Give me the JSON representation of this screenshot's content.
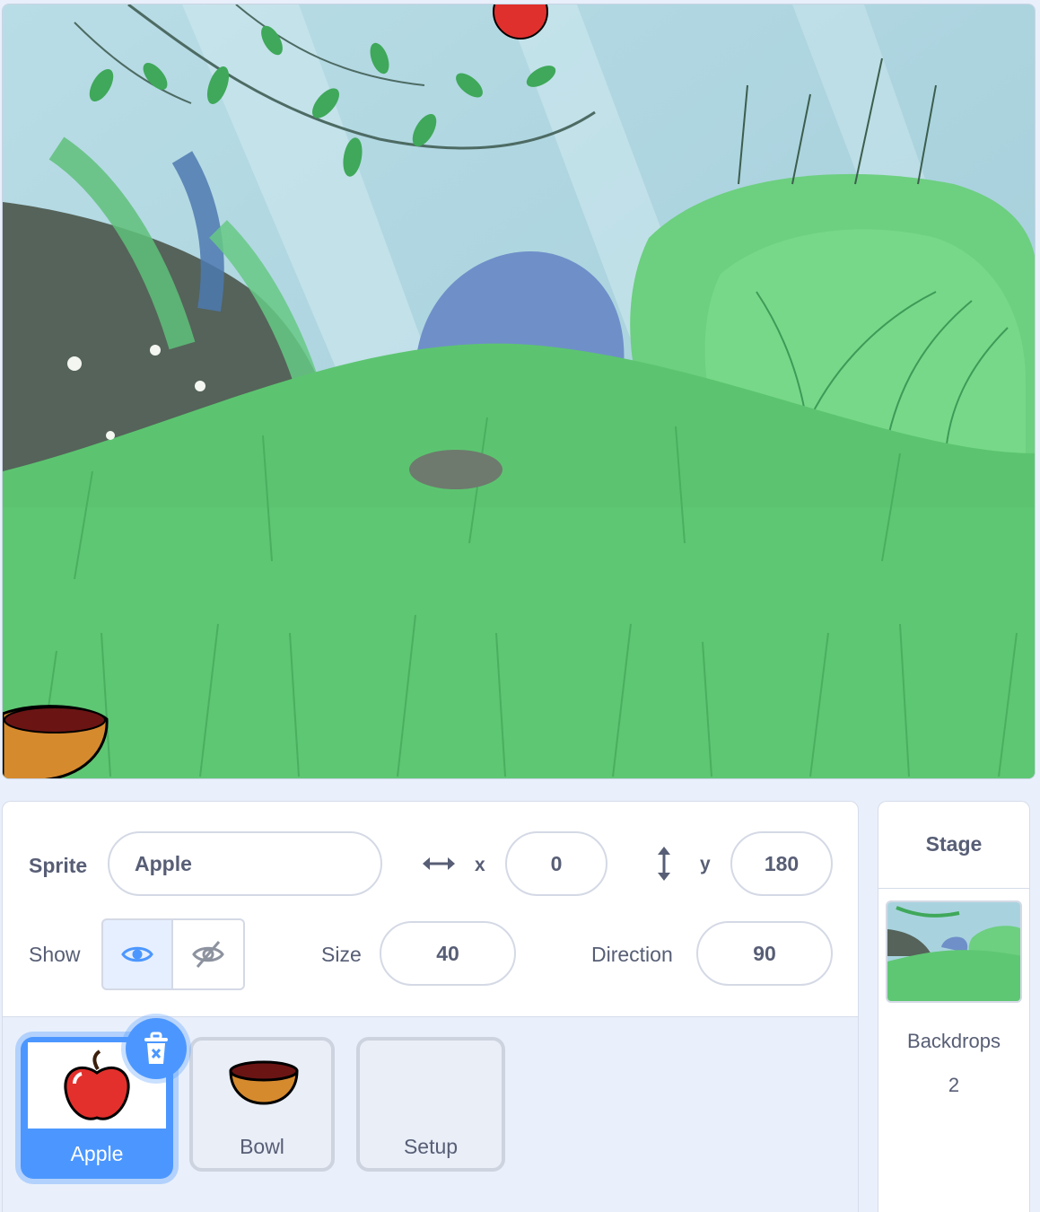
{
  "stage": {
    "backdrop_icon": "forest-backdrop",
    "sprites_on_stage": [
      "apple-sprite",
      "bowl-sprite"
    ]
  },
  "sprite_info": {
    "sprite_label": "Sprite",
    "sprite_name": "Apple",
    "x_label": "x",
    "x_value": "0",
    "y_label": "y",
    "y_value": "180",
    "show_label": "Show",
    "size_label": "Size",
    "size_value": "40",
    "direction_label": "Direction",
    "direction_value": "90",
    "visible": true
  },
  "sprite_list": {
    "sprites": [
      {
        "name": "Apple",
        "icon": "apple-icon",
        "selected": true
      },
      {
        "name": "Bowl",
        "icon": "bowl-icon",
        "selected": false
      },
      {
        "name": "Setup",
        "icon": "",
        "selected": false
      }
    ]
  },
  "stage_panel": {
    "title": "Stage",
    "backdrops_label": "Backdrops",
    "backdrops_count": "2"
  },
  "colors": {
    "accent": "#4c97ff",
    "text": "#575e75",
    "panel_bg": "#e9f0fb"
  }
}
